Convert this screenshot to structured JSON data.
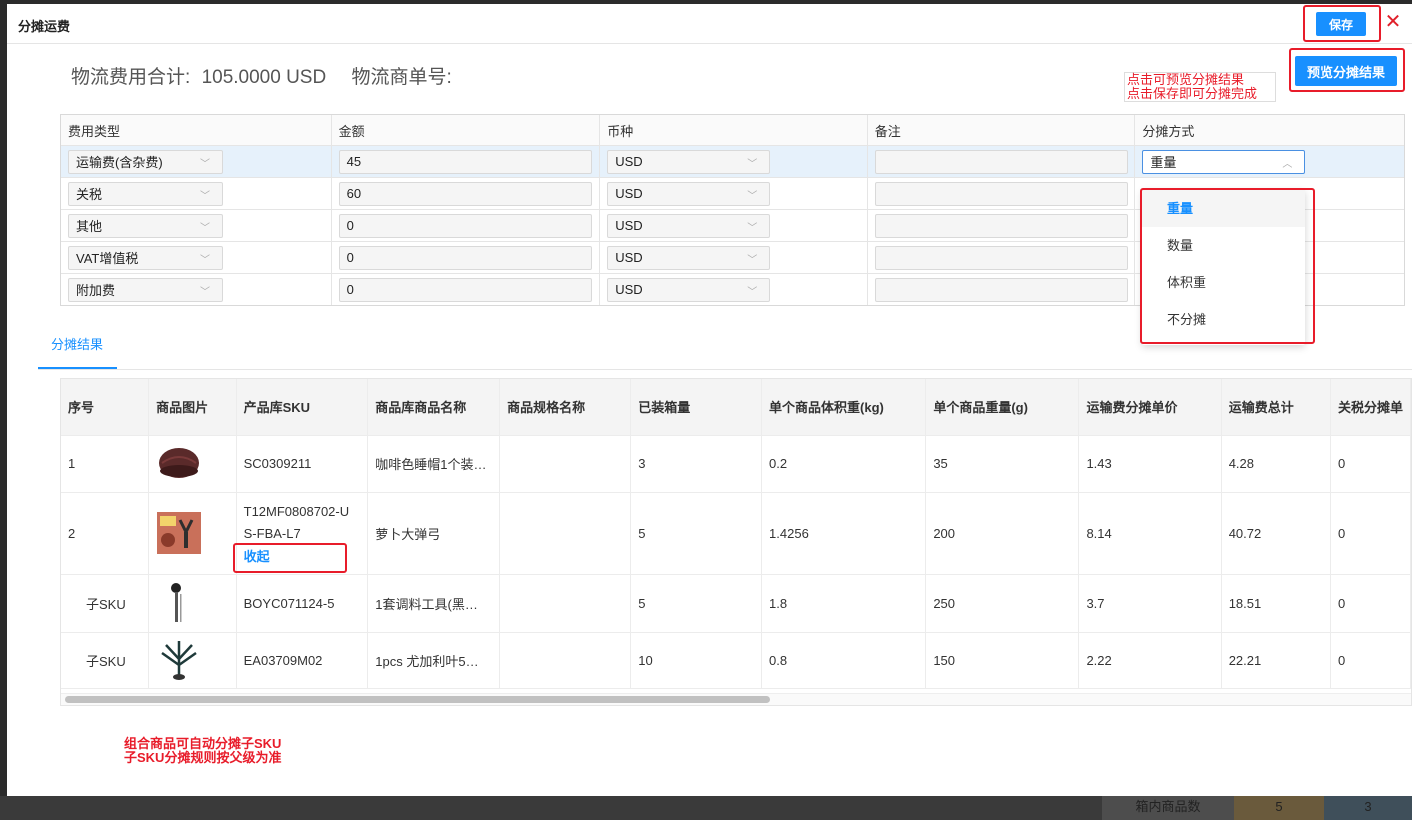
{
  "background": {
    "cells": [
      "箱内商品数",
      "5",
      "3"
    ]
  },
  "dialog": {
    "title": "分摊运费",
    "save_label": "保存",
    "close_symbol": "✕",
    "preview_label": "预览分摊结果",
    "note_top_line1": "点击可预览分摊结果",
    "note_top_line2": "点击保存即可分摊完成"
  },
  "summary": {
    "total_label": "物流费用合计:",
    "total_value": "105.0000 USD",
    "tracking_label": "物流商单号:"
  },
  "cost_table": {
    "headers": [
      "费用类型",
      "金额",
      "币种",
      "备注",
      "分摊方式"
    ],
    "rows": [
      {
        "type": "运输费(含杂费)",
        "amount": "45",
        "currency": "USD",
        "note": "",
        "method": "重量"
      },
      {
        "type": "关税",
        "amount": "60",
        "currency": "USD",
        "note": ""
      },
      {
        "type": "其他",
        "amount": "0",
        "currency": "USD",
        "note": ""
      },
      {
        "type": "VAT增值税",
        "amount": "0",
        "currency": "USD",
        "note": ""
      },
      {
        "type": "附加费",
        "amount": "0",
        "currency": "USD",
        "note": ""
      }
    ]
  },
  "dropdown": {
    "options": [
      "重量",
      "数量",
      "体积重",
      "不分摊"
    ],
    "selected": "重量"
  },
  "tabs": {
    "result_label": "分摊结果"
  },
  "result_table": {
    "headers": [
      "序号",
      "商品图片",
      "产品库SKU",
      "商品库商品名称",
      "商品规格名称",
      "已装箱量",
      "单个商品体积重(kg)",
      "单个商品重量(g)",
      "运输费分摊单价",
      "运输费总计",
      "关税分摊单"
    ],
    "rows": [
      {
        "index": "1",
        "sku": "SC0309211",
        "name": "咖啡色睡帽1个装…",
        "spec": "",
        "qty": "3",
        "vol_weight": "0.2",
        "weight": "35",
        "unit_price": "1.43",
        "total": "4.28",
        "tax": "0"
      },
      {
        "index": "2",
        "sku_line1": "T12MF0808702-U",
        "sku_line2": "S-FBA-L7",
        "collapse": "收起",
        "name": "萝卜大弹弓",
        "spec": "",
        "qty": "5",
        "vol_weight": "1.4256",
        "weight": "200",
        "unit_price": "8.14",
        "total": "40.72",
        "tax": "0"
      },
      {
        "index": "子SKU",
        "sku": "BOYC071124-5",
        "name": "1套调料工具(黑…",
        "spec": "",
        "qty": "5",
        "vol_weight": "1.8",
        "weight": "250",
        "unit_price": "3.7",
        "total": "18.51",
        "tax": "0"
      },
      {
        "index": "子SKU",
        "sku": "EA03709M02",
        "name": "1pcs 尤加利叶5…",
        "spec": "",
        "qty": "10",
        "vol_weight": "0.8",
        "weight": "150",
        "unit_price": "2.22",
        "total": "22.21",
        "tax": "0"
      }
    ]
  },
  "note_bottom": {
    "line1": "组合商品可自动分摊子SKU",
    "line2": "子SKU分摊规则按父级为准"
  },
  "colors": {
    "accent": "#1890ff",
    "annotation_red": "#e81c2a"
  }
}
